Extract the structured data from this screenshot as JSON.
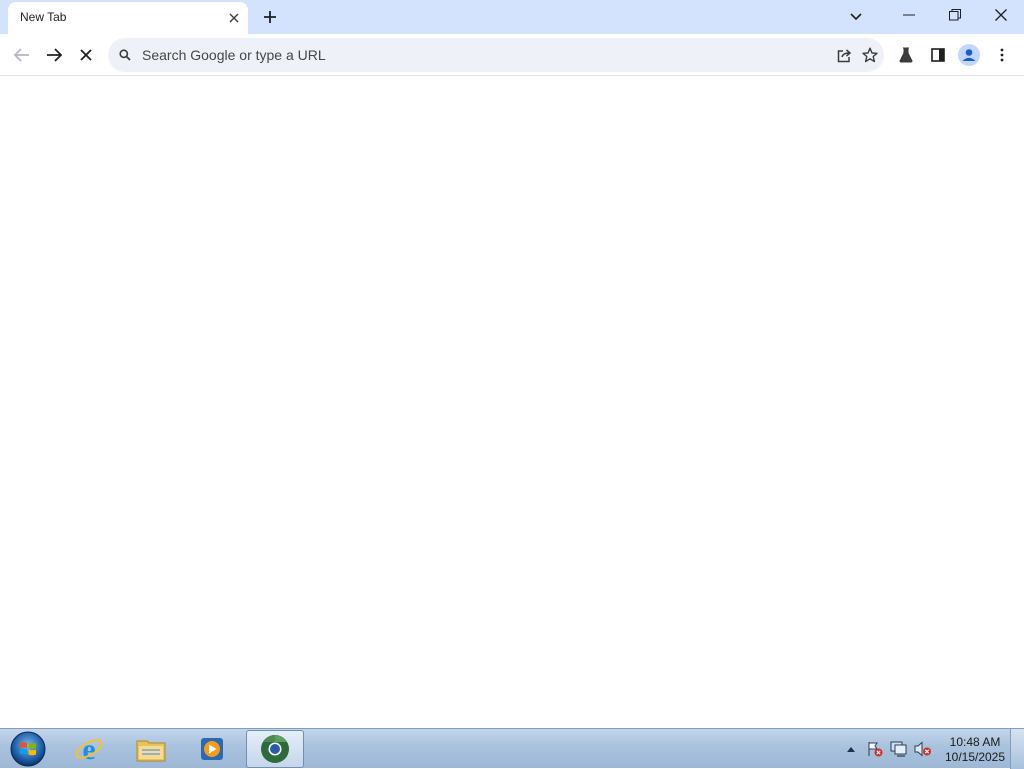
{
  "browser": {
    "tab": {
      "title": "New Tab"
    },
    "omnibox": {
      "placeholder": "Search Google or type a URL"
    },
    "window_controls": [
      "minimize",
      "restore",
      "close"
    ]
  },
  "taskbar": {
    "pinned": [
      "start-orb",
      "internet-explorer",
      "file-explorer",
      "media-player",
      "chrome"
    ],
    "active_app": "chrome",
    "tray": {
      "time": "10:48 AM",
      "date": "10/15/2025"
    }
  }
}
